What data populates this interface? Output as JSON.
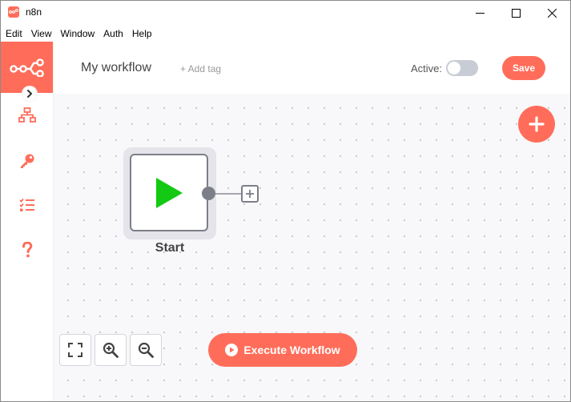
{
  "window": {
    "title": "n8n",
    "icon": "n8n-app-icon",
    "controls": [
      "minimize-icon",
      "maximize-icon",
      "close-icon"
    ]
  },
  "menu": {
    "items": [
      "Edit",
      "View",
      "Window",
      "Auth",
      "Help"
    ]
  },
  "sidebar": {
    "logo": "n8n-logo-icon",
    "collapse_icon": "chevron-right-icon",
    "items": [
      {
        "icon": "workflows-icon"
      },
      {
        "icon": "key-icon"
      },
      {
        "icon": "executions-list-icon"
      },
      {
        "icon": "help-icon"
      }
    ]
  },
  "header": {
    "workflow_name": "My workflow",
    "add_tag": "+ Add tag",
    "active_label": "Active:",
    "active": false,
    "save_label": "Save"
  },
  "canvas": {
    "add_node_icon": "plus-icon",
    "node": {
      "label": "Start",
      "icon": "play-icon"
    },
    "zoom_controls": [
      "fullscreen-icon",
      "zoom-in-icon",
      "zoom-out-icon"
    ],
    "execute_label": "Execute Workflow"
  },
  "colors": {
    "accent": "#ff6d5a",
    "play": "#13c913",
    "node_border": "#7d7f88"
  }
}
